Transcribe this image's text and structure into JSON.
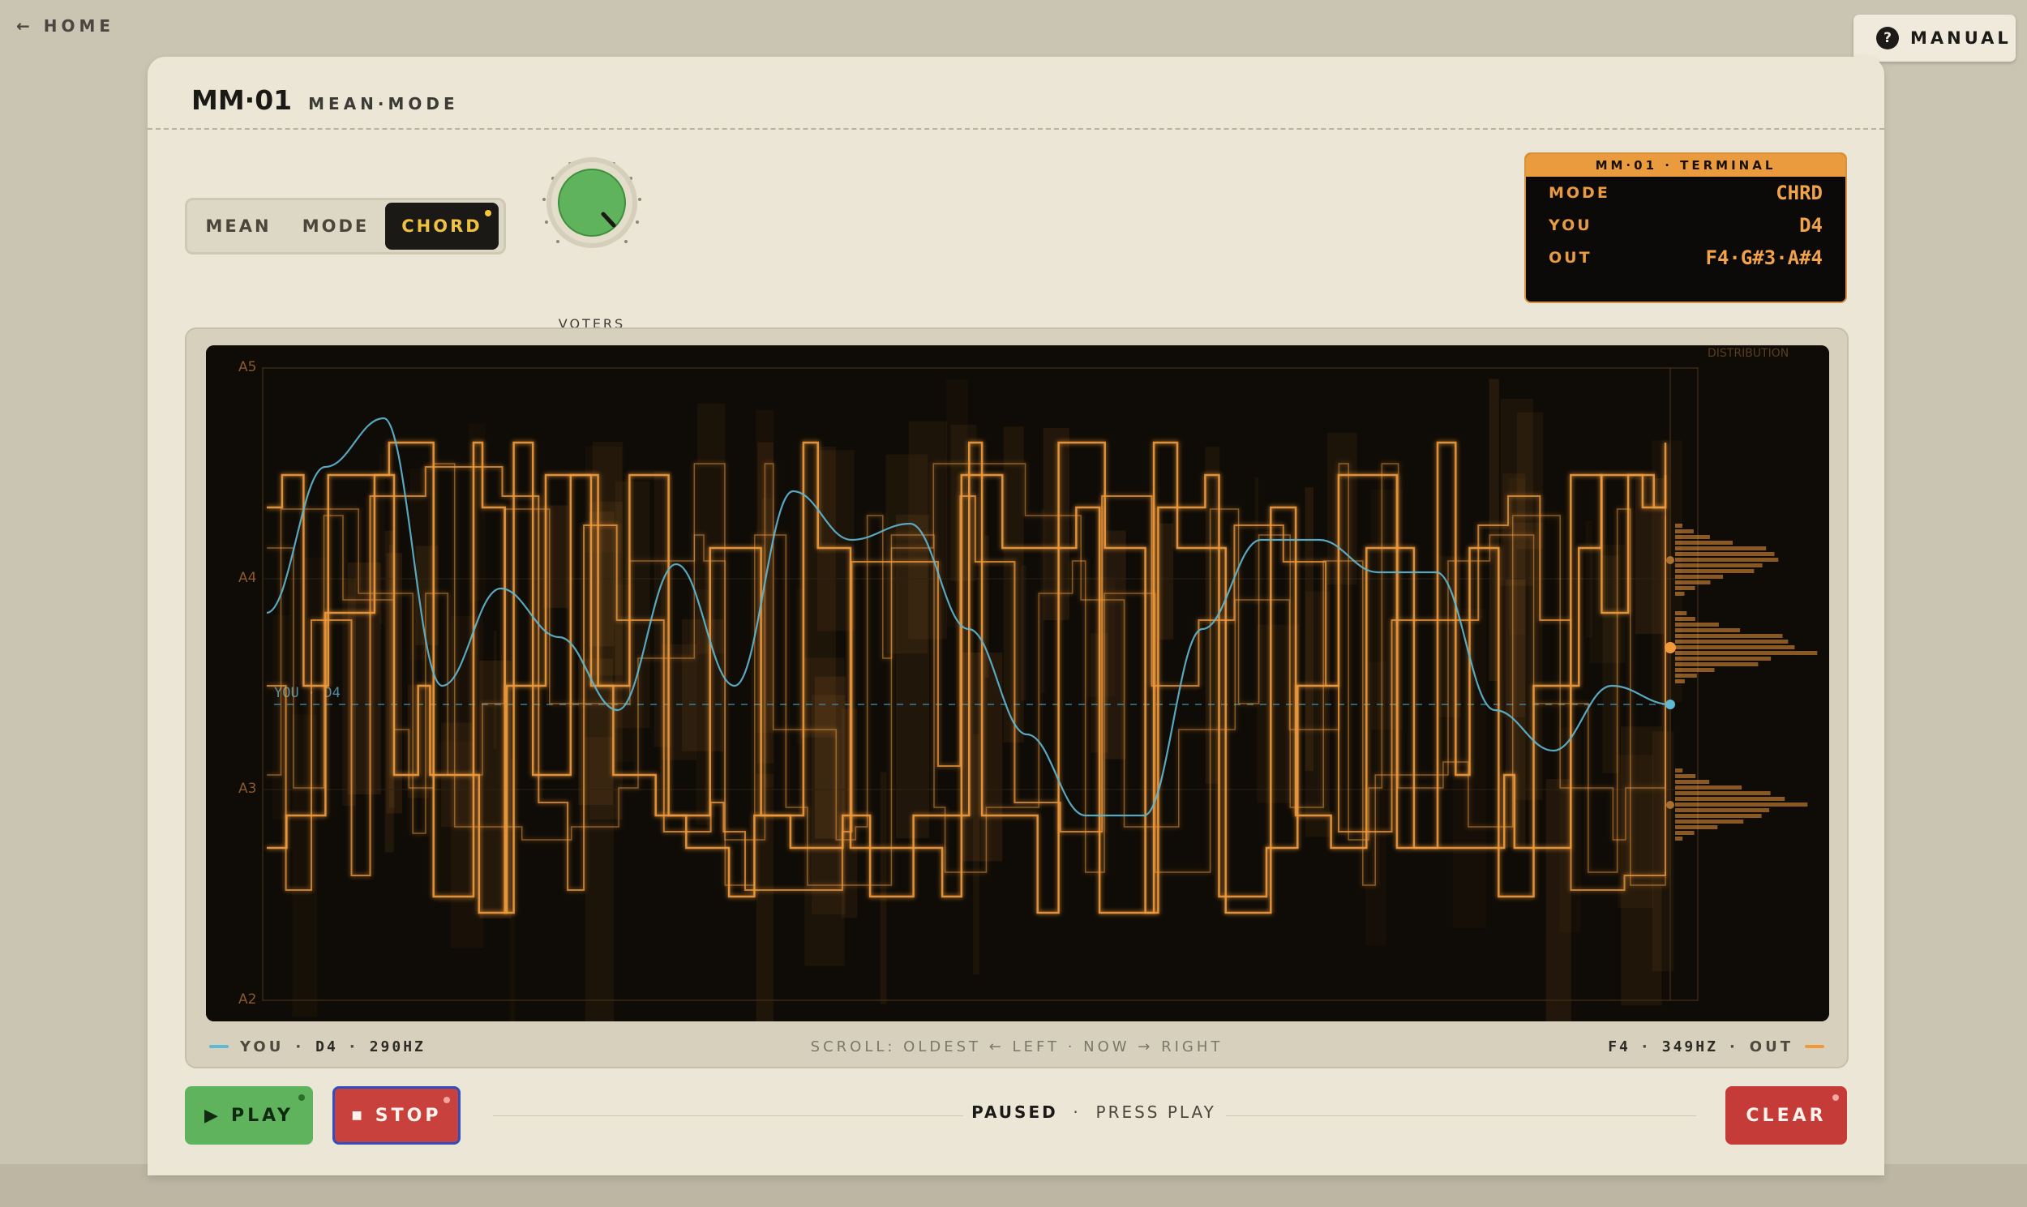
{
  "nav": {
    "home_label": "← HOME",
    "manual_label": "MANUAL",
    "manual_icon": "?"
  },
  "header": {
    "title": "MM·01",
    "subtitle": "MEAN·MODE"
  },
  "mode_switch": {
    "options": [
      "MEAN",
      "MODE",
      "CHORD"
    ],
    "selected": "CHORD"
  },
  "knob": {
    "label": "VOTERS",
    "value": "30k"
  },
  "terminal": {
    "title": "MM·01 · TERMINAL",
    "rows": [
      {
        "key": "MODE",
        "value": "CHRD"
      },
      {
        "key": "YOU",
        "value": "D4"
      },
      {
        "key": "OUT",
        "value": "F4·G#3·A#4"
      }
    ]
  },
  "scope": {
    "distribution_label": "DISTRIBUTION",
    "you_marker_label": "YOU · D4",
    "y_ticks": [
      "A5",
      "A4",
      "A3",
      "A2"
    ],
    "colors": {
      "you": "#5fb8d4",
      "out": "#f09a3c",
      "background": "#0f0b06"
    }
  },
  "footer": {
    "you_label": "YOU",
    "you_note": "D4",
    "you_freq": "290HZ",
    "scroll_hint": "SCROLL: OLDEST ← LEFT · NOW → RIGHT",
    "out_note": "F4",
    "out_freq": "349HZ",
    "out_label": "OUT"
  },
  "controls": {
    "play_label": "PLAY",
    "stop_label": "STOP",
    "clear_label": "CLEAR",
    "status_main": "PAUSED",
    "status_sub": "PRESS PLAY"
  }
}
